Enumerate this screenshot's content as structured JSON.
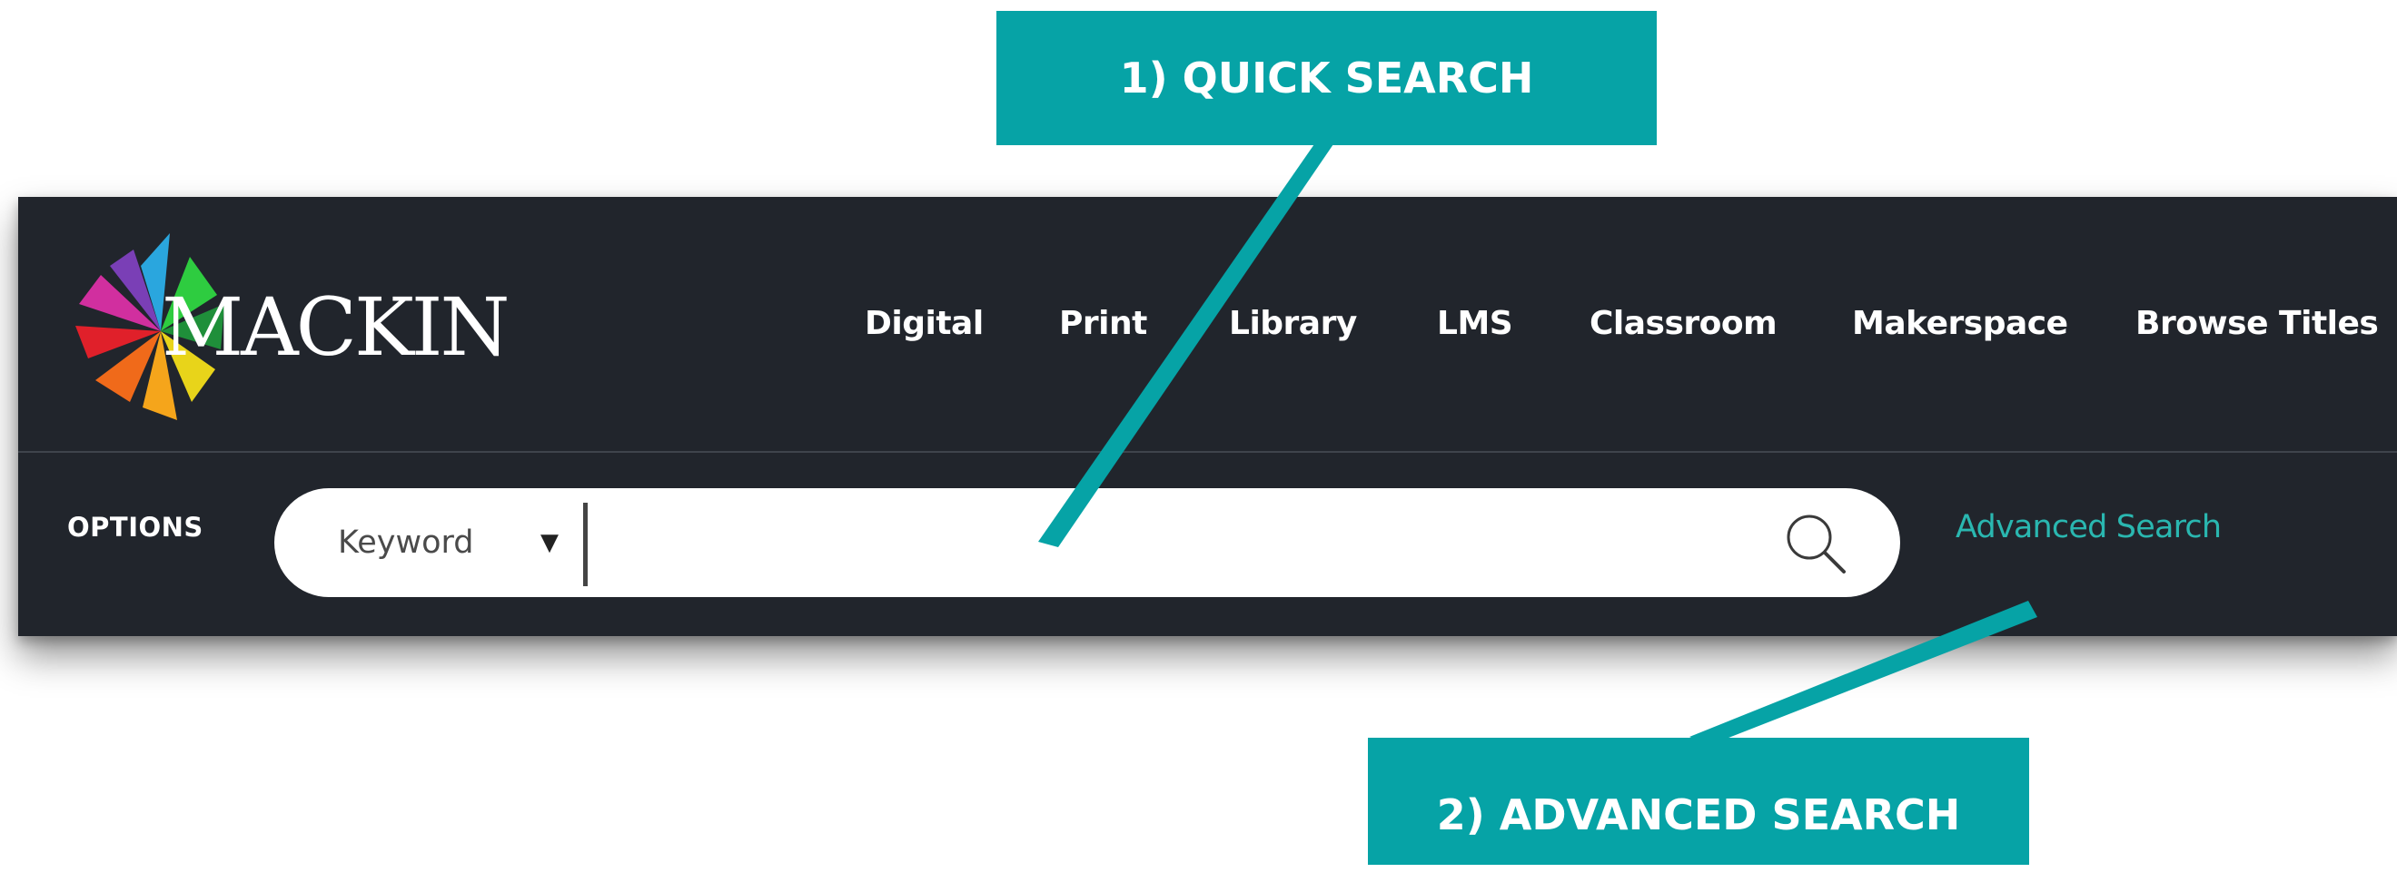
{
  "logo": {
    "text": "MACKIN"
  },
  "nav": {
    "items": [
      {
        "label": "Digital"
      },
      {
        "label": "Print"
      },
      {
        "label": "Library"
      },
      {
        "label": "LMS"
      },
      {
        "label": "Classroom"
      },
      {
        "label": "Makerspace"
      },
      {
        "label": "Browse Titles"
      }
    ]
  },
  "search": {
    "options_label": "OPTIONS",
    "type_selected": "Keyword",
    "dropdown_arrow": "▼",
    "value": "",
    "placeholder": "",
    "advanced_label": "Advanced Search"
  },
  "annotations": {
    "quick": "1) QUICK SEARCH",
    "advanced": "2) ADVANCED SEARCH"
  },
  "colors": {
    "header_bg": "#21252c",
    "accent_teal": "#06a3a6",
    "link_teal": "#2ab7b0"
  },
  "icons": {
    "logo_mark": "pinwheel-star",
    "search": "magnifier"
  }
}
